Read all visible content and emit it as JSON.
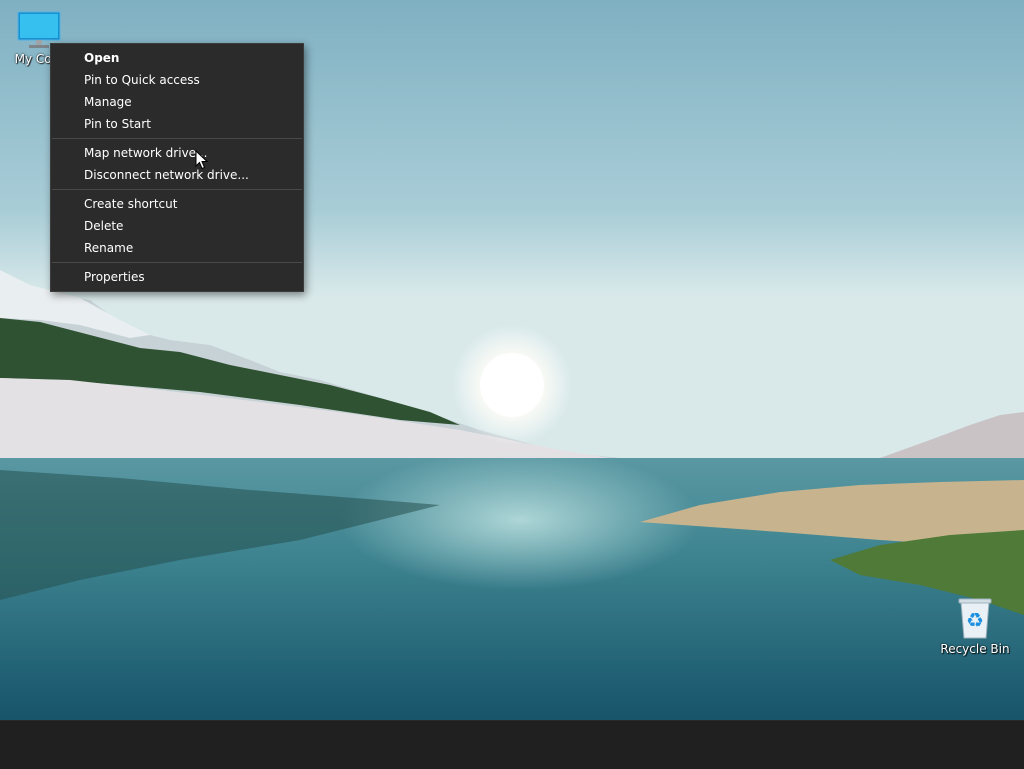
{
  "desktop": {
    "icons": [
      {
        "label": "My Com",
        "icon": "monitor-icon"
      },
      {
        "label": "Recycle Bin",
        "icon": "recycle-bin-icon"
      }
    ]
  },
  "context_menu": {
    "groups": [
      {
        "items": [
          {
            "label": "Open",
            "bold": true
          },
          {
            "label": "Pin to Quick access"
          },
          {
            "label": "Manage"
          },
          {
            "label": "Pin to Start"
          }
        ]
      },
      {
        "items": [
          {
            "label": "Map network drive..."
          },
          {
            "label": "Disconnect network drive..."
          }
        ]
      },
      {
        "items": [
          {
            "label": "Create shortcut"
          },
          {
            "label": "Delete"
          },
          {
            "label": "Rename"
          }
        ]
      },
      {
        "items": [
          {
            "label": "Properties"
          }
        ]
      }
    ]
  },
  "colors": {
    "menu_bg": "#2b2b2b",
    "menu_text": "#ffffff",
    "taskbar_bg": "#202020"
  },
  "cursor": {
    "icon": "arrow-cursor-icon"
  }
}
